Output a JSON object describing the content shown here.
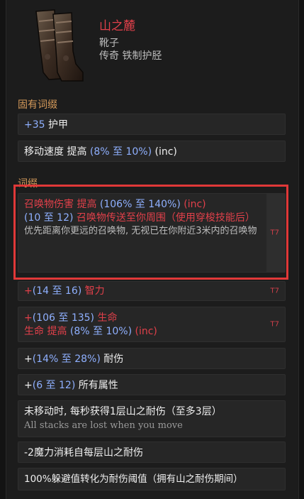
{
  "item": {
    "name": "山之麓",
    "type": "靴子",
    "rarity": "传奇 铁制护胫",
    "icon": "boots-icon"
  },
  "sections": {
    "implicit_title": "固有词缀",
    "explicit_title": "词缀"
  },
  "implicit": [
    {
      "plus": "+",
      "value": "35",
      "text": " 护甲"
    },
    {
      "text": "移动速度 提高 ",
      "range": "(8% 至 10%)",
      "suffix": " (inc)"
    }
  ],
  "explicit": {
    "mod1": {
      "line1_label": "召唤物伤害 提高 ",
      "line1_range": "(106% 至 140%)",
      "line1_suffix": " (inc)",
      "line2_range": "(10 至 12)",
      "line2_text": " 召唤物传送至你周围（使用穿梭技能后）",
      "desc": "优先距离你更远的召唤物, 无视已在你附近3米内的召唤物",
      "tier": "T7"
    },
    "mod2": {
      "prefix": "+",
      "range": "(14 至 16)",
      "text": " 智力",
      "tier": "T7"
    },
    "mod3": {
      "line1_prefix": "+",
      "line1_range": "(106 至 135)",
      "line1_text": " 生命",
      "line2_label": "生命 提高 ",
      "line2_range": "(8% 至 10%)",
      "line2_suffix": " (inc)",
      "tier": "T7"
    },
    "mod4": {
      "prefix": "+",
      "range": "(14% 至 28%)",
      "text": " 耐伤"
    },
    "mod5": {
      "prefix": "+",
      "range": "(6 至 12)",
      "text": " 所有属性"
    },
    "mod6": {
      "text": "未移动时, 每秒获得1层山之耐伤（至多3层）",
      "sub": "All stacks are lost when you move"
    },
    "mod7": {
      "text": "-2魔力消耗自每层山之耐伤"
    },
    "mod8": {
      "text": "100%躲避值转化为耐伤阈值（拥有山之耐伤期间）"
    }
  }
}
